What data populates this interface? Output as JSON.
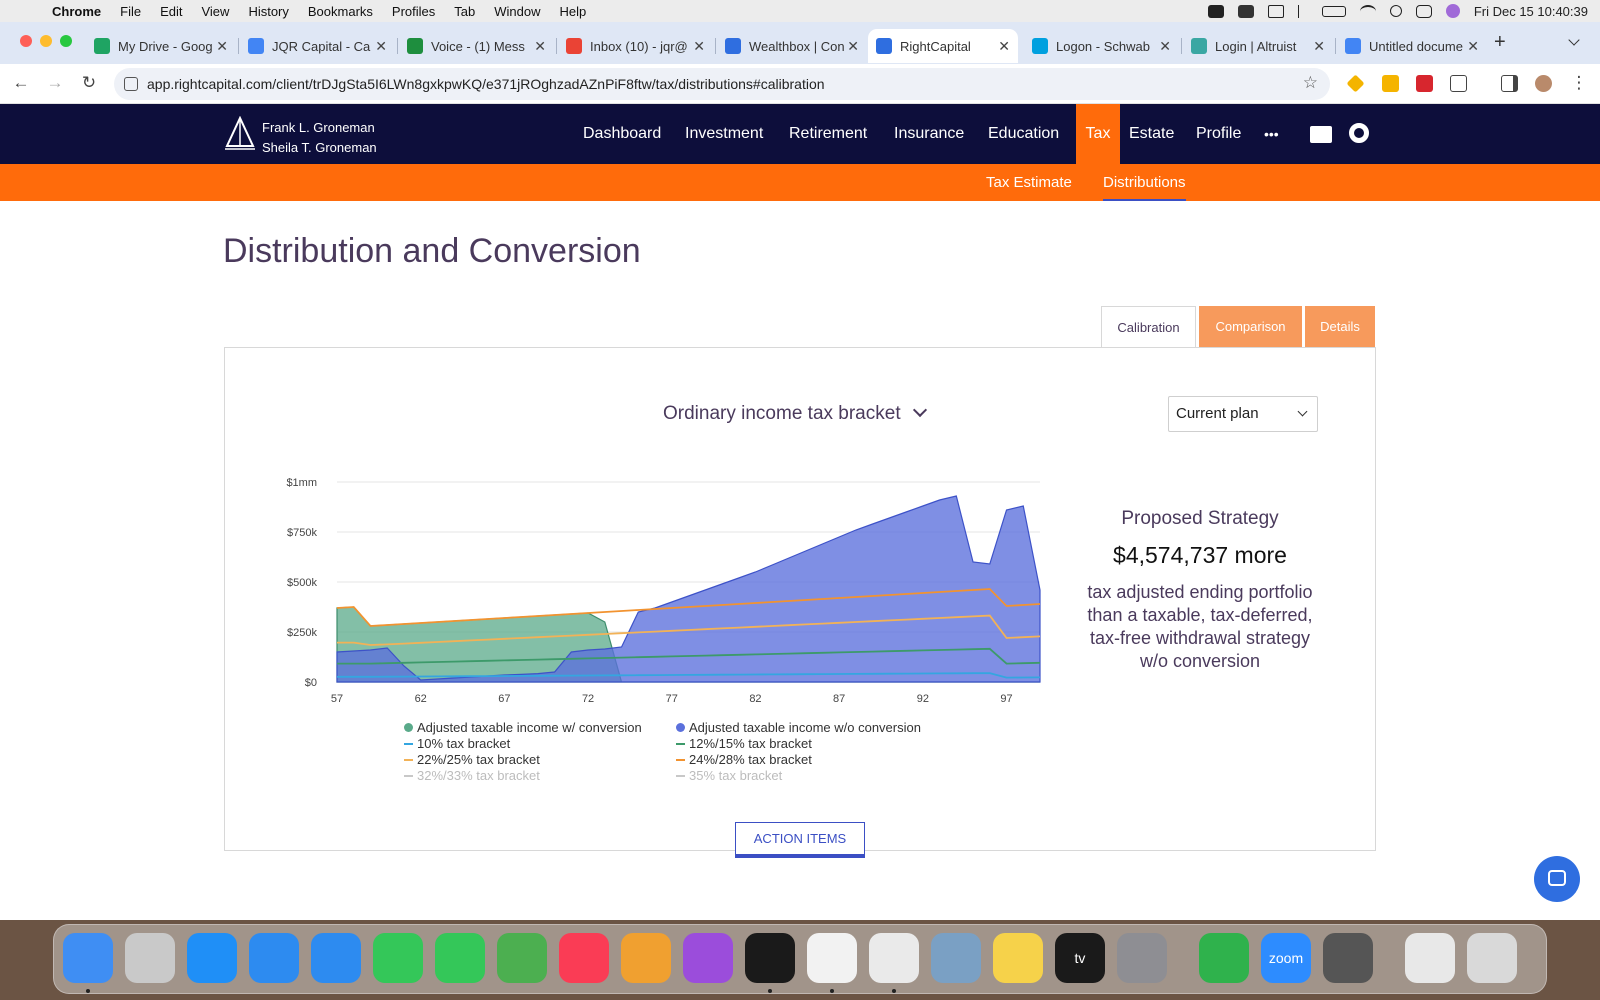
{
  "menubar": {
    "app": "Chrome",
    "items": [
      "File",
      "Edit",
      "View",
      "History",
      "Bookmarks",
      "Profiles",
      "Tab",
      "Window",
      "Help"
    ],
    "clock": "Fri Dec 15  10:40:39"
  },
  "tabs": [
    {
      "title": "My Drive - Goog",
      "color": "#1fa463"
    },
    {
      "title": "JQR Capital - Ca",
      "color": "#4285f4"
    },
    {
      "title": "Voice - (1) Mess",
      "color": "#1e8e3e"
    },
    {
      "title": "Inbox (10) - jqr@",
      "color": "#ea4335"
    },
    {
      "title": "Wealthbox | Con",
      "color": "#2f6ee0"
    },
    {
      "title": "RightCapital",
      "color": "#2f6ee0",
      "active": true
    },
    {
      "title": "Logon - Schwab",
      "color": "#00a0df"
    },
    {
      "title": "Login | Altruist",
      "color": "#3aa7a3"
    },
    {
      "title": "Untitled docume",
      "color": "#4285f4"
    }
  ],
  "url": "app.rightcapital.com/client/trDJgSta5I6LWn8gxkpwKQ/e371jROghzadAZnPiF8ftw/tax/distributions#calibration",
  "client": {
    "line1": "Frank L. Groneman",
    "line2": "Sheila T. Groneman"
  },
  "nav": {
    "items": [
      "Dashboard",
      "Investment",
      "Retirement",
      "Insurance",
      "Education",
      "Tax",
      "Estate",
      "Profile"
    ],
    "active": "Tax",
    "more": "•••"
  },
  "subnav": {
    "items": [
      "Tax Estimate",
      "Distributions"
    ],
    "active": "Distributions"
  },
  "page": {
    "title": "Distribution and Conversion"
  },
  "view_tabs": [
    "Calibration",
    "Comparison",
    "Details"
  ],
  "controls": {
    "metric": "Ordinary income tax bracket",
    "plan": "Current plan"
  },
  "chart_data": {
    "type": "area",
    "x": [
      57,
      58,
      59,
      60,
      61,
      62,
      63,
      64,
      65,
      66,
      67,
      68,
      69,
      70,
      71,
      72,
      73,
      74,
      75,
      76,
      77,
      78,
      79,
      80,
      81,
      82,
      83,
      84,
      85,
      86,
      87,
      88,
      89,
      90,
      91,
      92,
      93,
      94,
      95,
      96,
      97,
      98,
      99
    ],
    "x_ticks": [
      57,
      62,
      67,
      72,
      77,
      82,
      87,
      92,
      97
    ],
    "y_ticks": [
      "$0",
      "$250k",
      "$500k",
      "$750k",
      "$1mm"
    ],
    "ylim": [
      0,
      1000000
    ],
    "series": [
      {
        "name": "Adjusted taxable income w/ conversion",
        "color": "#5aaa8a",
        "kind": "area",
        "values": [
          370000,
          375000,
          280000,
          285000,
          290000,
          295000,
          300000,
          305000,
          310000,
          315000,
          320000,
          325000,
          330000,
          335000,
          340000,
          345000,
          300000,
          0,
          0,
          0,
          0,
          0,
          0,
          0,
          0,
          0,
          0,
          0,
          0,
          0,
          0,
          0,
          0,
          0,
          0,
          0,
          0,
          0,
          0,
          0,
          0,
          0,
          0
        ]
      },
      {
        "name": "Adjusted taxable income w/o conversion",
        "color": "#5b70dc",
        "kind": "area",
        "values": [
          150000,
          155000,
          160000,
          170000,
          80000,
          10000,
          15000,
          20000,
          25000,
          30000,
          35000,
          38000,
          42000,
          50000,
          150000,
          160000,
          165000,
          175000,
          350000,
          370000,
          400000,
          430000,
          460000,
          490000,
          520000,
          550000,
          585000,
          620000,
          655000,
          690000,
          725000,
          760000,
          790000,
          820000,
          850000,
          880000,
          910000,
          930000,
          600000,
          590000,
          860000,
          880000,
          460000
        ]
      },
      {
        "name": "10% tax bracket",
        "color": "#34a6e0",
        "kind": "line",
        "values": [
          26000,
          26000,
          26000,
          26500,
          27000,
          27500,
          28000,
          28500,
          29000,
          29500,
          30000,
          30500,
          31000,
          31500,
          32000,
          32500,
          33000,
          33500,
          34000,
          34500,
          35000,
          35500,
          36000,
          36500,
          37000,
          37500,
          38000,
          38500,
          39000,
          39500,
          40000,
          40500,
          41000,
          41500,
          42000,
          42500,
          43000,
          43500,
          44000,
          44500,
          22000,
          22500,
          23000
        ]
      },
      {
        "name": "12%/15% tax bracket",
        "color": "#3d9a6a",
        "kind": "line",
        "values": [
          92000,
          92000,
          92000,
          94000,
          96000,
          98000,
          100000,
          102000,
          104000,
          106000,
          108000,
          110000,
          112000,
          114000,
          116000,
          118000,
          120000,
          122000,
          124000,
          126000,
          128000,
          130000,
          132000,
          134000,
          136000,
          138000,
          140000,
          142000,
          144000,
          146000,
          148000,
          150000,
          152000,
          154000,
          156000,
          158000,
          160000,
          162000,
          164000,
          166000,
          92000,
          94000,
          96000
        ]
      },
      {
        "name": "22%/25% tax bracket",
        "color": "#f2b257",
        "kind": "line",
        "values": [
          197000,
          197000,
          185000,
          188000,
          192000,
          196000,
          200000,
          204000,
          208000,
          212000,
          216000,
          220000,
          224000,
          228000,
          232000,
          236000,
          240000,
          244000,
          248000,
          252000,
          256000,
          260000,
          264000,
          268000,
          272000,
          276000,
          280000,
          284000,
          288000,
          292000,
          296000,
          300000,
          304000,
          308000,
          312000,
          316000,
          320000,
          324000,
          328000,
          332000,
          220000,
          224000,
          228000
        ]
      },
      {
        "name": "24%/28% tax bracket",
        "color": "#f29330",
        "kind": "line",
        "values": [
          370000,
          375000,
          280000,
          285000,
          290000,
          295000,
          300000,
          305000,
          310000,
          315000,
          320000,
          325000,
          330000,
          335000,
          340000,
          345000,
          350000,
          355000,
          360000,
          365000,
          370000,
          375000,
          380000,
          385000,
          390000,
          395000,
          400000,
          405000,
          410000,
          415000,
          420000,
          425000,
          430000,
          435000,
          440000,
          445000,
          450000,
          455000,
          460000,
          465000,
          380000,
          385000,
          390000
        ]
      },
      {
        "name": "32%/33% tax bracket",
        "color": "#c8c8c8",
        "kind": "hidden",
        "values": []
      },
      {
        "name": "35% tax bracket",
        "color": "#c8c8c8",
        "kind": "hidden",
        "values": []
      }
    ]
  },
  "summary": {
    "heading": "Proposed Strategy",
    "value": "$4,574,737 more",
    "description": "tax adjusted ending portfolio than a taxable, tax-deferred, tax-free withdrawal strategy w/o conversion"
  },
  "action_button": "ACTION ITEMS",
  "dock": {
    "icons": [
      "finder-icon",
      "launchpad-icon",
      "app-store-icon",
      "mail-icon",
      "safari-icon",
      "facetime-icon",
      "messages-icon",
      "maps-icon",
      "music-icon",
      "photos-icon",
      "podcasts-icon",
      "stocks-icon",
      "news-icon",
      "chrome-icon",
      "preview-icon",
      "notes-icon",
      "tv-icon",
      "settings-icon",
      "numbers-icon",
      "zoom-icon",
      "calculator-icon",
      "documents-icon",
      "trash-icon"
    ],
    "colors": [
      "#3f8ef3",
      "#c9c9c9",
      "#1f8ff7",
      "#2d8bf0",
      "#2d8bf0",
      "#34c759",
      "#34c759",
      "#4caf50",
      "#fa3c55",
      "#f0a030",
      "#9b4ddb",
      "#1a1a1a",
      "#f2f2f2",
      "#eaeaea",
      "#7aa0c4",
      "#f6d24a",
      "#1a1a1a",
      "#8e8e93",
      "#2fb24c",
      "#2d8cff",
      "#555555",
      "#e8e8e8",
      "#d9d9d9"
    ],
    "tv_label": "tv",
    "zoom_label": "zoom"
  }
}
